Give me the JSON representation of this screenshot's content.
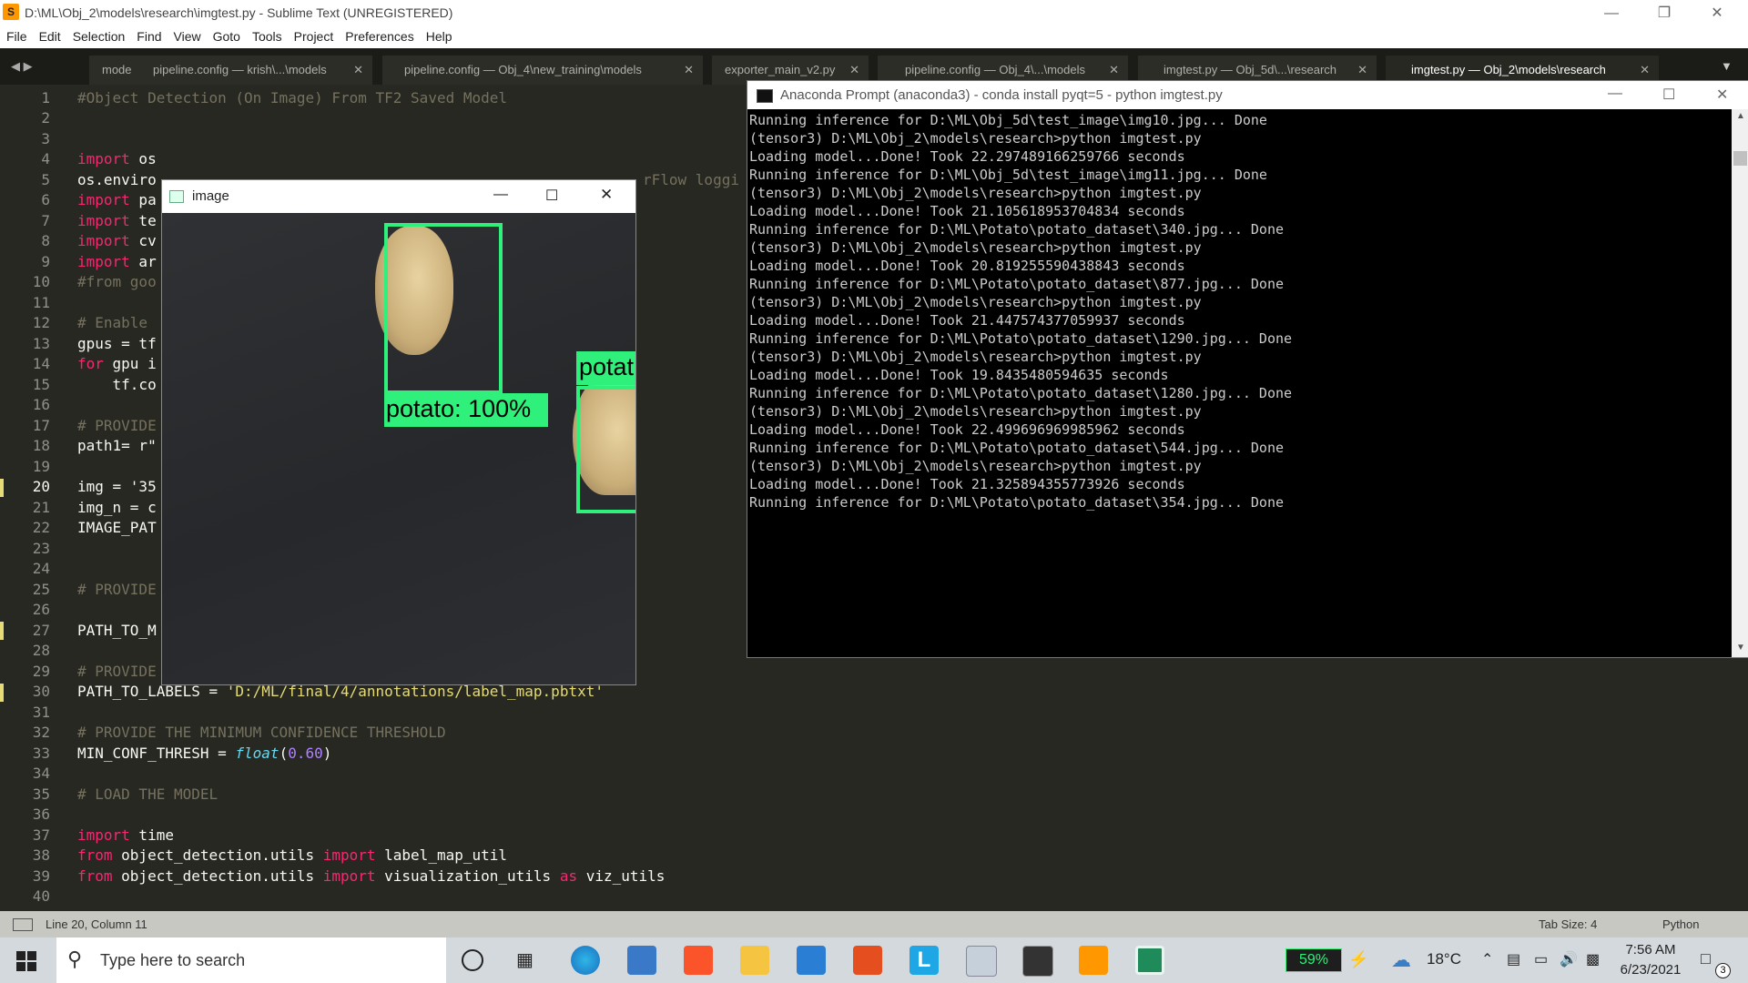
{
  "sublime": {
    "title": "D:\\ML\\Obj_2\\models\\research\\imgtest.py - Sublime Text (UNREGISTERED)",
    "menu": [
      "File",
      "Edit",
      "Selection",
      "Find",
      "View",
      "Goto",
      "Tools",
      "Project",
      "Preferences",
      "Help"
    ],
    "tabs": [
      "mode",
      "pipeline.config — krish\\...\\models",
      "pipeline.config — Obj_4\\new_training\\models",
      "exporter_main_v2.py",
      "pipeline.config — Obj_4\\...\\models",
      "imgtest.py — Obj_5d\\...\\research",
      "imgtest.py — Obj_2\\models\\research"
    ],
    "line_numbers": [
      "1",
      "2",
      "3",
      "4",
      "5",
      "6",
      "7",
      "8",
      "9",
      "10",
      "11",
      "12",
      "13",
      "14",
      "15",
      "16",
      "17",
      "18",
      "19",
      "20",
      "21",
      "22",
      "23",
      "24",
      "25",
      "26",
      "27",
      "28",
      "29",
      "30",
      "31",
      "32",
      "33",
      "34",
      "35",
      "36",
      "37",
      "38",
      "39",
      "40"
    ],
    "code_text": {
      "l1": "#Object Detection (On Image) From TF2 Saved Model",
      "l4_k": "import",
      "l4": " os",
      "l5": "os.enviro",
      "l5_tail": "rFlow loggi",
      "l6_k": "import",
      "l6": " pa",
      "l7_k": "import",
      "l7": " te",
      "l8_k": "import",
      "l8": " cv",
      "l9_k": "import",
      "l9": " ar",
      "l10": "#from goo",
      "l12": "# Enable",
      "l13": "gpus = tf",
      "l14_k": "for",
      "l14": " gpu i",
      "l15": "    tf.co",
      "l17": "# PROVIDE",
      "l18": "path1= r\"",
      "l20": "img = '35",
      "l21": "img_n = c",
      "l22": "IMAGE_PAT",
      "l25": "# PROVIDE",
      "l27": "PATH_TO_M",
      "l29": "# PROVIDE",
      "l30": "PATH_TO_LABELS = ",
      "l30_s": "'D:/ML/final/4/annotations/label_map.pbtxt'",
      "l32": "# PROVIDE THE MINIMUM CONFIDENCE THRESHOLD",
      "l33": "MIN_CONF_THRESH = ",
      "l33_f": "float",
      "l33_a": "(",
      "l33_n": "0.60",
      "l33_b": ")",
      "l35": "# LOAD THE MODEL",
      "l37_k": "import",
      "l37": " time",
      "l38_k": "from",
      "l38a": " object_detection.utils ",
      "l38_k2": "import",
      "l38b": " label_map_util",
      "l39_k": "from",
      "l39a": " object_detection.utils ",
      "l39_k2": "import",
      "l39b": " visualization_utils ",
      "l39_k3": "as",
      "l39c": " viz_utils"
    },
    "status_left": "Line 20, Column 11",
    "status_tab_size": "Tab Size: 4",
    "status_syntax": "Python"
  },
  "conda": {
    "title": "Anaconda Prompt (anaconda3) - conda  install pyqt=5 - python  imgtest.py",
    "lines": [
      "Running inference for D:\\ML\\Obj_5d\\test_image\\img10.jpg... Done",
      "",
      "(tensor3) D:\\ML\\Obj_2\\models\\research>python imgtest.py",
      "Loading model...Done! Took 22.297489166259766 seconds",
      "Running inference for D:\\ML\\Obj_5d\\test_image\\img11.jpg... Done",
      "",
      "(tensor3) D:\\ML\\Obj_2\\models\\research>python imgtest.py",
      "Loading model...Done! Took 21.105618953704834 seconds",
      "Running inference for D:\\ML\\Potato\\potato_dataset\\340.jpg... Done",
      "",
      "(tensor3) D:\\ML\\Obj_2\\models\\research>python imgtest.py",
      "Loading model...Done! Took 20.819255590438843 seconds",
      "Running inference for D:\\ML\\Potato\\potato_dataset\\877.jpg... Done",
      "",
      "(tensor3) D:\\ML\\Obj_2\\models\\research>python imgtest.py",
      "Loading model...Done! Took 21.447574377059937 seconds",
      "Running inference for D:\\ML\\Potato\\potato_dataset\\1290.jpg... Done",
      "",
      "(tensor3) D:\\ML\\Obj_2\\models\\research>python imgtest.py",
      "Loading model...Done! Took 19.8435480594635 seconds",
      "Running inference for D:\\ML\\Potato\\potato_dataset\\1280.jpg... Done",
      "",
      "(tensor3) D:\\ML\\Obj_2\\models\\research>python imgtest.py",
      "Loading model...Done! Took 22.499696969985962 seconds",
      "Running inference for D:\\ML\\Potato\\potato_dataset\\544.jpg... Done",
      "",
      "(tensor3) D:\\ML\\Obj_2\\models\\research>python imgtest.py",
      "Loading model...Done! Took 21.325894355773926 seconds",
      "Running inference for D:\\ML\\Potato\\potato_dataset\\354.jpg... Done"
    ]
  },
  "image_window": {
    "title": "image",
    "detections": [
      "potato: 100%",
      "potat"
    ]
  },
  "taskbar": {
    "search_placeholder": "Type here to search",
    "battery": "59%",
    "temperature": "18°C",
    "time": "7:56 AM",
    "date": "6/23/2021",
    "notifications": "3"
  },
  "colors": {
    "editor_bg": "#272822",
    "keyword": "#f92672",
    "comment": "#75715e",
    "string": "#e6db74",
    "detection": "#2ff07a"
  }
}
